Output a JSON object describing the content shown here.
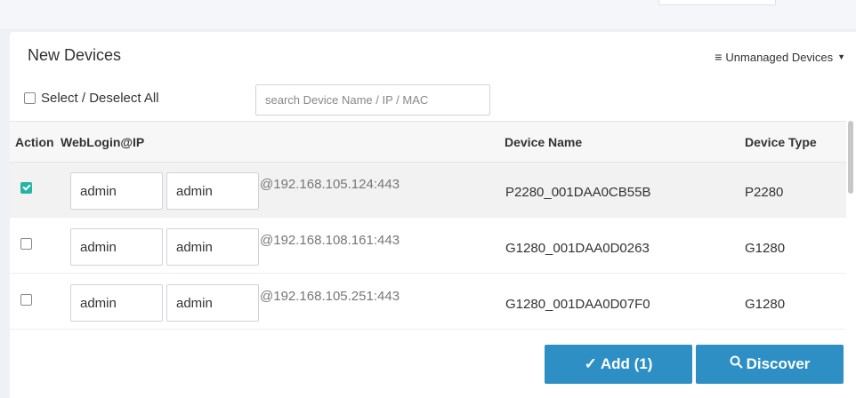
{
  "panel": {
    "title": "New Devices",
    "menu_label": "Unmanaged Devices",
    "select_all_label": "Select / Deselect All",
    "search_placeholder": "search Device Name / IP / MAC"
  },
  "table": {
    "headers": {
      "action": "Action",
      "weblogin": "WebLogin@IP",
      "device_name": "Device Name",
      "device_type": "Device Type"
    },
    "rows": [
      {
        "checked": true,
        "username": "admin",
        "password": "admin",
        "ip": "@192.168.105.124:443",
        "device_name": "P2280_001DAA0CB55B",
        "device_type": "P2280"
      },
      {
        "checked": false,
        "username": "admin",
        "password": "admin",
        "ip": "@192.168.108.161:443",
        "device_name": "G1280_001DAA0D0263",
        "device_type": "G1280"
      },
      {
        "checked": false,
        "username": "admin",
        "password": "admin",
        "ip": "@192.168.105.251:443",
        "device_name": "G1280_001DAA0D07F0",
        "device_type": "G1280"
      }
    ]
  },
  "actions": {
    "add_label": "Add (1)",
    "discover_label": "Discover"
  },
  "colors": {
    "button": "#2d8fc4",
    "checkbox_checked": "#26b5a4"
  },
  "icons": {
    "menu": "hamburger-icon",
    "add": "check-icon",
    "discover": "search-icon"
  }
}
